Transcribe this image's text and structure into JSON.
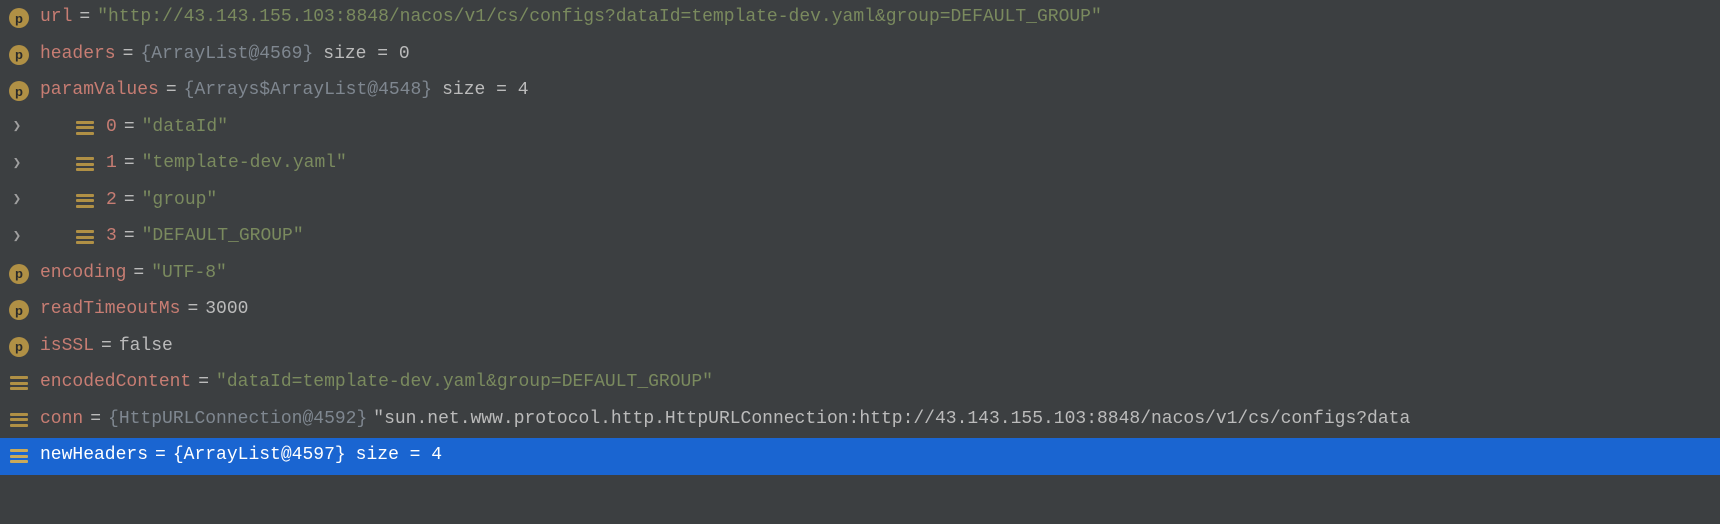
{
  "rows": {
    "url": {
      "name": "url",
      "value": "\"http://43.143.155.103:8848/nacos/v1/cs/configs?dataId=template-dev.yaml&group=DEFAULT_GROUP\""
    },
    "headers": {
      "name": "headers",
      "obj": "{ArrayList@4569}",
      "size": "size = 0"
    },
    "paramValues": {
      "name": "paramValues",
      "obj": "{Arrays$ArrayList@4548}",
      "size": "size = 4"
    },
    "p0": {
      "name": "0",
      "value": "\"dataId\""
    },
    "p1": {
      "name": "1",
      "value": "\"template-dev.yaml\""
    },
    "p2": {
      "name": "2",
      "value": "\"group\""
    },
    "p3": {
      "name": "3",
      "value": "\"DEFAULT_GROUP\""
    },
    "encoding": {
      "name": "encoding",
      "value": "\"UTF-8\""
    },
    "readTimeoutMs": {
      "name": "readTimeoutMs",
      "value": "3000"
    },
    "isSSL": {
      "name": "isSSL",
      "value": "false"
    },
    "encodedContent": {
      "name": "encodedContent",
      "value": "\"dataId=template-dev.yaml&group=DEFAULT_GROUP\""
    },
    "conn": {
      "name": "conn",
      "obj": "{HttpURLConnection@4592}",
      "tostr": "\"sun.net.www.protocol.http.HttpURLConnection:http://43.143.155.103:8848/nacos/v1/cs/configs?data"
    },
    "newHeaders": {
      "name": "newHeaders",
      "obj": "{ArrayList@4597}",
      "size": "size = 4"
    }
  },
  "glyphs": {
    "p": "p"
  }
}
